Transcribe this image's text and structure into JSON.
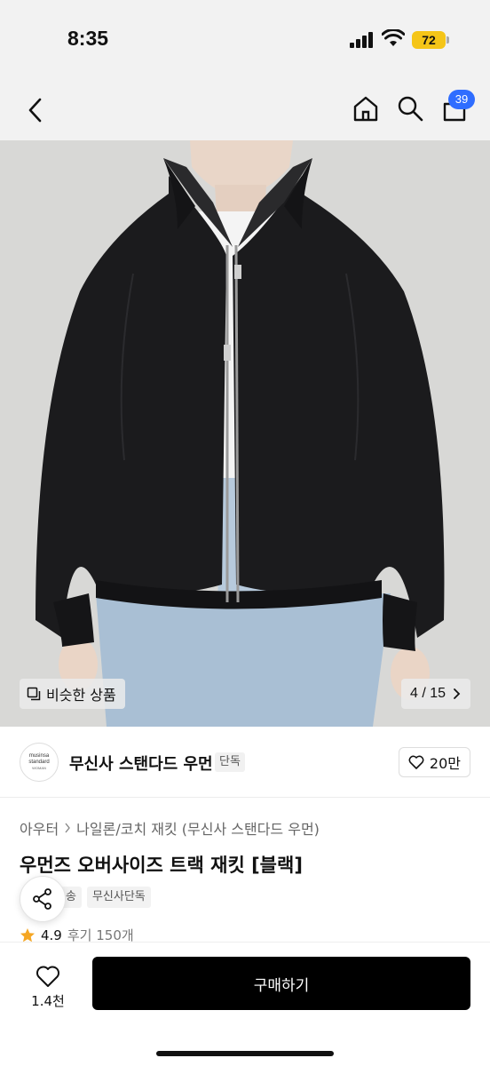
{
  "status_bar": {
    "time": "8:35",
    "battery": "72"
  },
  "nav": {
    "back_icon": "chevron-left-icon",
    "home_icon": "home-icon",
    "search_icon": "search-icon",
    "cart_icon": "shopping-bag-icon",
    "cart_badge": "39",
    "badge_color": "#2f6dff"
  },
  "product_image": {
    "similar_label": "비슷한 상품",
    "page_indicator": "4 / 15"
  },
  "brand": {
    "logo_line1": "musinsa",
    "logo_line2": "standard",
    "logo_line3": "WOMAN",
    "name": "무신사 스탠다드 우먼",
    "tag": "단독",
    "like_count": "20만"
  },
  "product": {
    "breadcrumb": [
      "아우터",
      "나일론/코치 재킷 (무신사 스탠다드 우먼)"
    ],
    "title": "우먼즈 오버사이즈 트랙 재킷 [블랙]",
    "tags": [
      "송",
      "무신사단독"
    ],
    "rating": "4.9",
    "reviews": "후기 150개"
  },
  "bottom_bar": {
    "wish_count": "1.4천",
    "buy_label": "구매하기"
  }
}
